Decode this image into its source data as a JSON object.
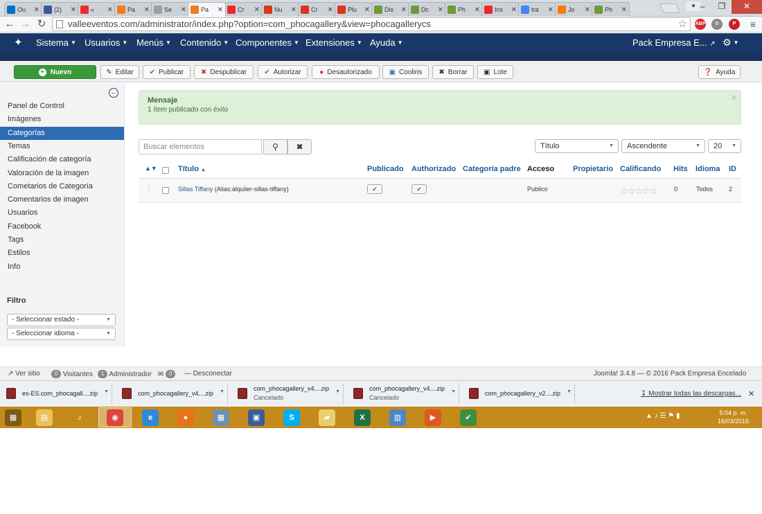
{
  "browser": {
    "tabs": [
      {
        "label": "Ou",
        "icon": "outlook-icon",
        "color": "#0072c6"
      },
      {
        "label": "(2)",
        "icon": "facebook-icon",
        "color": "#3b5998"
      },
      {
        "label": "«",
        "icon": "youtube-icon",
        "color": "#e52d27"
      },
      {
        "label": "Pa",
        "icon": "joomla-icon",
        "color": "#f07c21"
      },
      {
        "label": "Se",
        "icon": "page-icon",
        "color": "#9aa0a6"
      },
      {
        "label": "Pa",
        "icon": "joomla-icon",
        "color": "#f07c21"
      },
      {
        "label": "Cr",
        "icon": "youtube-icon",
        "color": "#e52d27"
      },
      {
        "label": "Nu",
        "icon": "w-icon",
        "color": "#d9361b"
      },
      {
        "label": "Cr",
        "icon": "w-icon",
        "color": "#d9361b"
      },
      {
        "label": "Plu",
        "icon": "w-icon",
        "color": "#d9361b"
      },
      {
        "label": "Dis",
        "icon": "phoca-icon",
        "color": "#6e9a3a"
      },
      {
        "label": "Dc",
        "icon": "phoca-icon",
        "color": "#6e9a3a"
      },
      {
        "label": "Ph",
        "icon": "phoca-icon",
        "color": "#6e9a3a"
      },
      {
        "label": "Ins",
        "icon": "youtube-icon",
        "color": "#e52d27"
      },
      {
        "label": "tra",
        "icon": "google-icon",
        "color": "#4285f4"
      },
      {
        "label": "Jo",
        "icon": "blogger-icon",
        "color": "#f57d00"
      },
      {
        "label": "Ph",
        "icon": "phoca-icon",
        "color": "#6e9a3a"
      }
    ],
    "active_tab_index": 5,
    "url": "valleeventos.com/administrator/index.php?option=com_phocagallery&view=phocagallerycs",
    "extensions": [
      {
        "label": "ABP",
        "icon": "adblock-icon",
        "color": "#d9262b"
      },
      {
        "label": "⚙",
        "icon": "extension-gear-icon",
        "color": "#8a8a8a"
      },
      {
        "label": "P",
        "icon": "pinterest-icon",
        "color": "#cb2027"
      }
    ]
  },
  "joomla": {
    "menu": [
      {
        "label": "Sistema"
      },
      {
        "label": "Usuarios"
      },
      {
        "label": "Menús"
      },
      {
        "label": "Contenido"
      },
      {
        "label": "Componentes"
      },
      {
        "label": "Extensiones"
      },
      {
        "label": "Ayuda"
      }
    ],
    "site_name": "Pack Empresa E...",
    "toolbar": {
      "nuevo": "Nuevo",
      "editar": "Editar",
      "publicar": "Publicar",
      "despublicar": "Despublicar",
      "autorizar": "Autorizar",
      "desautorizar": "Desautorizado",
      "cooliris": "Cooliris",
      "borrar": "Borrar",
      "lote": "Lote",
      "ayuda": "Ayuda"
    },
    "sidebar": {
      "items": [
        {
          "label": "Panel de Control"
        },
        {
          "label": "Imágenes"
        },
        {
          "label": "Categorías"
        },
        {
          "label": "Temas"
        },
        {
          "label": "Calificación de categoría"
        },
        {
          "label": "Valoración de la imagen"
        },
        {
          "label": "Cometarios de Categoría"
        },
        {
          "label": "Comentarios de imagen"
        },
        {
          "label": "Usuarios"
        },
        {
          "label": "Facebook"
        },
        {
          "label": "Tags"
        },
        {
          "label": "Estilos"
        },
        {
          "label": "Info"
        }
      ],
      "active_index": 2,
      "filter_title": "Filtro",
      "filter_state": "- Seleccionar estado -",
      "filter_language": "- Seleccionar idioma -"
    },
    "message": {
      "title": "Mensaje",
      "text": "1 ítem publicado con éxito"
    },
    "search": {
      "placeholder": "Buscar elementos",
      "sort_field": "Título",
      "sort_order": "Ascendente",
      "limit": "20"
    },
    "table": {
      "columns": {
        "titulo": "Título",
        "publicado": "Publicado",
        "autorizado": "Authorizado",
        "categoria_padre": "Categoría padre",
        "acceso": "Acceso",
        "propietario": "Propietario",
        "calificando": "Calificando",
        "hits": "Hits",
        "idioma": "Idioma",
        "id": "ID"
      },
      "rows": [
        {
          "title": "Sillas Tiffany",
          "alias": "(Alias:alquiler-sillas-tiffany)",
          "published": true,
          "authorized": true,
          "access": "Publico",
          "rating_stars": 0,
          "hits": "0",
          "language": "Todos",
          "id": "2"
        }
      ]
    },
    "status": {
      "ver_sitio": "Ver sitio",
      "visitors_count": "0",
      "visitors_label": "Visitantes",
      "admins_count": "1",
      "admins_label": "Administrador",
      "messages_count": "0",
      "disconnect": "Desconectar",
      "version": "Joomla! 3.4.8  —  © 2016 Pack Empresa Encelado"
    }
  },
  "downloads": {
    "items": [
      {
        "name": "es-ES.com_phocagall....zip",
        "status": ""
      },
      {
        "name": "com_phocagallery_v4....zip",
        "status": ""
      },
      {
        "name": "com_phocagallery_v4....zip",
        "status": "Cancelado"
      },
      {
        "name": "com_phocagallery_v4....zip",
        "status": "Cancelado"
      },
      {
        "name": "com_phocagallery_v2....zip",
        "status": ""
      }
    ],
    "show_all": "Mostrar todas las descargas..."
  },
  "taskbar": {
    "apps": [
      {
        "icon": "windows-start-icon",
        "label": "▦",
        "color": "#7a5a18"
      },
      {
        "icon": "file-explorer-icon",
        "label": "▤",
        "color": "#e9c25b"
      },
      {
        "icon": "itunes-icon",
        "label": "♪",
        "color": "#c48a1c"
      },
      {
        "icon": "chrome-icon",
        "label": "◉",
        "color": "#e0443b"
      },
      {
        "icon": "internet-explorer-icon",
        "label": "e",
        "color": "#2f89d6"
      },
      {
        "icon": "firefox-icon",
        "label": "●",
        "color": "#e8711b"
      },
      {
        "icon": "calculator-icon",
        "label": "▦",
        "color": "#6f8fb0"
      },
      {
        "icon": "network-icon",
        "label": "▣",
        "color": "#3b5e9a"
      },
      {
        "icon": "skype-icon",
        "label": "S",
        "color": "#00aff0"
      },
      {
        "icon": "folder-icon",
        "label": "▰",
        "color": "#e8cf72"
      },
      {
        "icon": "excel-icon",
        "label": "X",
        "color": "#1f7145"
      },
      {
        "icon": "reader-icon",
        "label": "▥",
        "color": "#4d86c6"
      },
      {
        "icon": "media-player-icon",
        "label": "▶",
        "color": "#e0581d"
      },
      {
        "icon": "spreadsheet-icon",
        "label": "✔",
        "color": "#3f8f3f"
      }
    ],
    "selected_index": 3,
    "time": "5:04 p. m.",
    "date": "16/03/2016"
  }
}
